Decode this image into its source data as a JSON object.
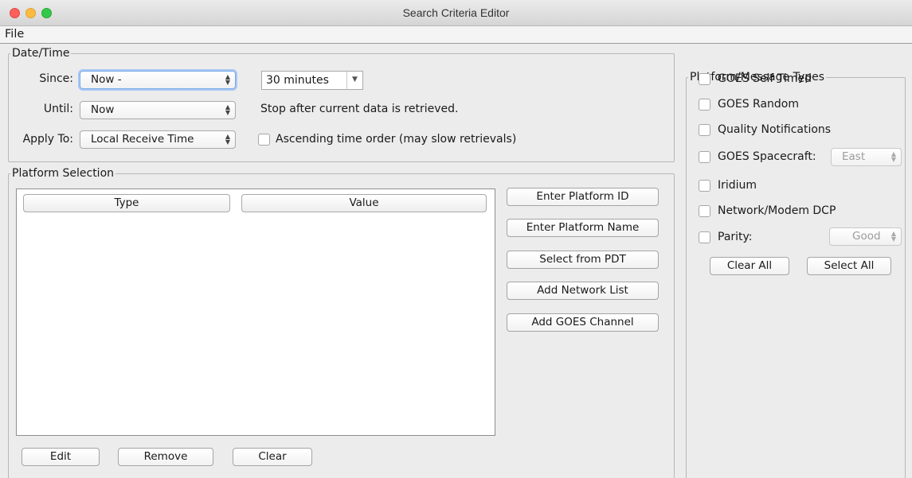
{
  "window": {
    "title": "Search Criteria Editor"
  },
  "menu": {
    "file": "File"
  },
  "datetime": {
    "legend": "Date/Time",
    "since_label": "Since:",
    "since_value": "Now -",
    "duration_value": "30 minutes",
    "until_label": "Until:",
    "until_value": "Now",
    "until_note": "Stop after current data is retrieved.",
    "apply_label": "Apply To:",
    "apply_value": "Local Receive Time",
    "ascending_label": "Ascending time order (may slow retrievals)"
  },
  "platform_selection": {
    "legend": "Platform Selection",
    "columns": [
      "Type",
      "Value"
    ],
    "buttons": {
      "enter_id": "Enter Platform ID",
      "enter_name": "Enter Platform Name",
      "select_pdt": "Select from PDT",
      "add_network_list": "Add Network List",
      "add_goes_channel": "Add GOES Channel",
      "edit": "Edit",
      "remove": "Remove",
      "clear": "Clear"
    }
  },
  "message_types": {
    "legend": "Platform/Message Types",
    "items": [
      "GOES Self Timed",
      "GOES Random",
      "Quality Notifications",
      "GOES Spacecraft:",
      "Iridium",
      "Network/Modem DCP",
      "Parity:"
    ],
    "spacecraft_value": "East",
    "parity_value": "Good",
    "clear_all": "Clear All",
    "select_all": "Select All"
  }
}
